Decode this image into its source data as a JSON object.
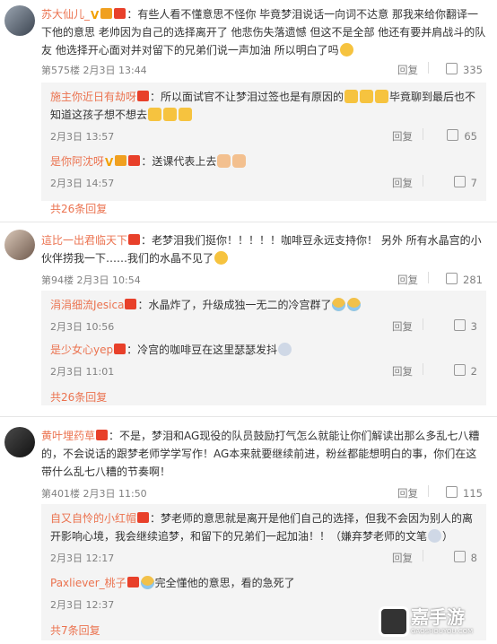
{
  "comments": [
    {
      "username": "苏大仙儿_",
      "text": "：有些人看不懂意思不怪你 毕竟梦泪说话一向词不达意 那我来给你翻译一下他的意思 老帅因为自己的选择离开了 他悲伤失落遗憾 但这不是全部 他还有要并肩战斗的队友 他选择开心面对并对留下的兄弟们说一声加油 所以明白了吗",
      "meta": "第575楼 2月3日 13:44",
      "reply": "回复",
      "likes": "335",
      "replies": [
        {
          "username": "施主你近日有劫呀",
          "text": "：所以面试官不让梦泪过签也是有原因的",
          "text2": "毕竟聊到最后也不知道这孩子想不想去",
          "time": "2月3日 13:57",
          "reply": "回复",
          "likes": "65"
        },
        {
          "username": "是你阿沈呀",
          "text": "：送课代表上去",
          "time": "2月3日 14:57",
          "reply": "回复",
          "likes": "7"
        }
      ],
      "more": "共26条回复"
    },
    {
      "username": "這比一出君临天下",
      "text": "：老梦泪我们挺你！！！！！咖啡豆永远支持你！ 另外 所有水晶宫的小伙伴捞我一下……我们的水晶不见了",
      "meta": "第94楼 2月3日 10:54",
      "reply": "回复",
      "likes": "281",
      "replies": [
        {
          "username": "涓涓细流Jesica",
          "text": "：水晶炸了，升级成独一无二的冷宫群了",
          "time": "2月3日 10:56",
          "reply": "回复",
          "likes": "3"
        },
        {
          "username": "是少女心yep",
          "text": "：冷宫的咖啡豆在这里瑟瑟发抖",
          "time": "2月3日 11:01",
          "reply": "回复",
          "likes": "2"
        }
      ],
      "more": "共26条回复"
    },
    {
      "username": "黄叶埋药草",
      "text": "：不是，梦泪和AG现役的队员鼓励打气怎么就能让你们解读出那么多乱七八糟的，不会说话的跟梦老师学学写作！AG本来就要继续前进，粉丝都能想明白的事，你们在这带什么乱七八糟的节奏啊！",
      "meta": "第401楼 2月3日 11:50",
      "reply": "回复",
      "likes": "115",
      "replies": [
        {
          "username": "自又自怜的小红帽",
          "text": "：梦老师的意思就是离开是他们自己的选择，但我不会因为别人的离开影响心境，我会继续追梦，和留下的兄弟们一起加油！！（嫌弃梦老师的文笔",
          "text2": "）",
          "time": "2月3日 12:17",
          "reply": "回复",
          "likes": "8"
        },
        {
          "username": "Paxliever_桃子",
          "text": "完全懂他的意思，看的急死了",
          "time": "2月3日 12:37"
        }
      ],
      "more": "共7条回复"
    }
  ],
  "watermark": {
    "name": "嘉手游",
    "url": "GAOSHOUYOU.COM"
  }
}
